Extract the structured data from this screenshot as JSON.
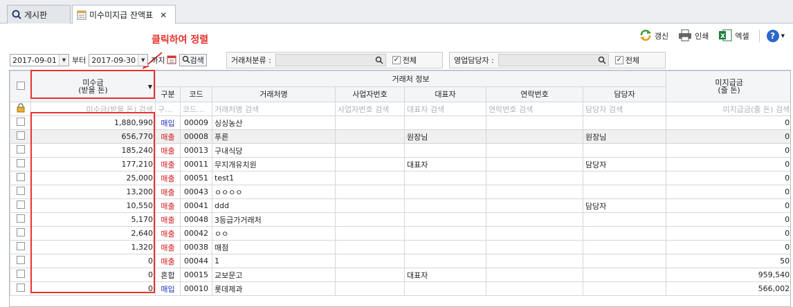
{
  "tabs": [
    {
      "label": "게시판",
      "icon": "search-icon"
    },
    {
      "label": "미수미지급 잔액표",
      "icon": "ledger-icon",
      "close": "✕"
    }
  ],
  "toolbar": {
    "refresh": "갱신",
    "print": "인쇄",
    "excel": "엑셀",
    "help": "?"
  },
  "annotation": "클릭하여 정렬",
  "filters": {
    "date_from": "2017-09-01",
    "from_label": "부터",
    "date_to": "2017-09-30",
    "to_label": "까지",
    "search_label": "검색",
    "group1_label": "거래처분류 :",
    "group1_all": "전체",
    "group2_label": "영업담당자 :",
    "group2_all": "전체"
  },
  "grid": {
    "group_header": "거래처 정보",
    "col_receivable": "미수금\n(받을 돈)",
    "col_type": "구분",
    "col_code": "코드",
    "col_name": "거래처명",
    "col_bizno": "사업자번호",
    "col_ceo": "대표자",
    "col_phone": "연락번호",
    "col_manager": "담당자",
    "col_payable": "미지급금\n(줄 돈)",
    "f_receivable": "미수금(받을 돈) 검색",
    "f_type": "구...",
    "f_code": "코드...",
    "f_name": "거래처명 검색",
    "f_bizno": "사업자번호 검색",
    "f_ceo": "대표자 검색",
    "f_phone": "연락번호 검색",
    "f_manager": "담당자 검색",
    "f_payable": "미지급금(줄 돈) 검색",
    "rows": [
      {
        "receivable": "1,880,990",
        "type": "매입",
        "kind": "buy",
        "code": "00009",
        "name": "싱싱농산",
        "bizno": "",
        "ceo": "",
        "phone": "",
        "manager": "",
        "payable": "0"
      },
      {
        "receivable": "656,770",
        "type": "매출",
        "kind": "sell",
        "code": "00008",
        "name": "푸른",
        "bizno": "",
        "ceo": "원장님",
        "phone": "",
        "manager": "원장님",
        "payable": "0"
      },
      {
        "receivable": "185,240",
        "type": "매출",
        "kind": "sell",
        "code": "00013",
        "name": "구내식당",
        "bizno": "",
        "ceo": "",
        "phone": "",
        "manager": "",
        "payable": "0"
      },
      {
        "receivable": "177,210",
        "type": "매출",
        "kind": "sell",
        "code": "00011",
        "name": "무지개유치원",
        "bizno": "",
        "ceo": "대표자",
        "phone": "",
        "manager": "담당자",
        "payable": "0"
      },
      {
        "receivable": "25,000",
        "type": "매출",
        "kind": "sell",
        "code": "00051",
        "name": "test1",
        "bizno": "",
        "ceo": "",
        "phone": "",
        "manager": "",
        "payable": "0"
      },
      {
        "receivable": "13,200",
        "type": "매출",
        "kind": "sell",
        "code": "00043",
        "name": "ㅇㅇㅇㅇ",
        "bizno": "",
        "ceo": "",
        "phone": "",
        "manager": "",
        "payable": "0"
      },
      {
        "receivable": "10,550",
        "type": "매출",
        "kind": "sell",
        "code": "00041",
        "name": "ddd",
        "bizno": "",
        "ceo": "",
        "phone": "",
        "manager": "담당자",
        "payable": "0"
      },
      {
        "receivable": "5,170",
        "type": "매출",
        "kind": "sell",
        "code": "00048",
        "name": "3등급가거래처",
        "bizno": "",
        "ceo": "",
        "phone": "",
        "manager": "",
        "payable": "0"
      },
      {
        "receivable": "2,640",
        "type": "매출",
        "kind": "sell",
        "code": "00042",
        "name": "ㅇㅇ",
        "bizno": "",
        "ceo": "",
        "phone": "",
        "manager": "",
        "payable": "0"
      },
      {
        "receivable": "1,320",
        "type": "매출",
        "kind": "sell",
        "code": "00038",
        "name": "매점",
        "bizno": "",
        "ceo": "",
        "phone": "",
        "manager": "",
        "payable": "0"
      },
      {
        "receivable": "0",
        "type": "매출",
        "kind": "sell",
        "code": "00044",
        "name": "1",
        "bizno": "",
        "ceo": "",
        "phone": "",
        "manager": "",
        "payable": "50"
      },
      {
        "receivable": "0",
        "type": "혼합",
        "kind": "mix",
        "code": "00015",
        "name": "교보문고",
        "bizno": "",
        "ceo": "대표자",
        "phone": "",
        "manager": "",
        "payable": "959,540"
      },
      {
        "receivable": "0",
        "type": "매입",
        "kind": "buy",
        "code": "00010",
        "name": "롯데제과",
        "bizno": "",
        "ceo": "",
        "phone": "",
        "manager": "",
        "payable": "566,002"
      }
    ]
  },
  "colors": {
    "annotation": "#e8312c",
    "buy": "#1d2fbf",
    "sell": "#d2191e"
  }
}
